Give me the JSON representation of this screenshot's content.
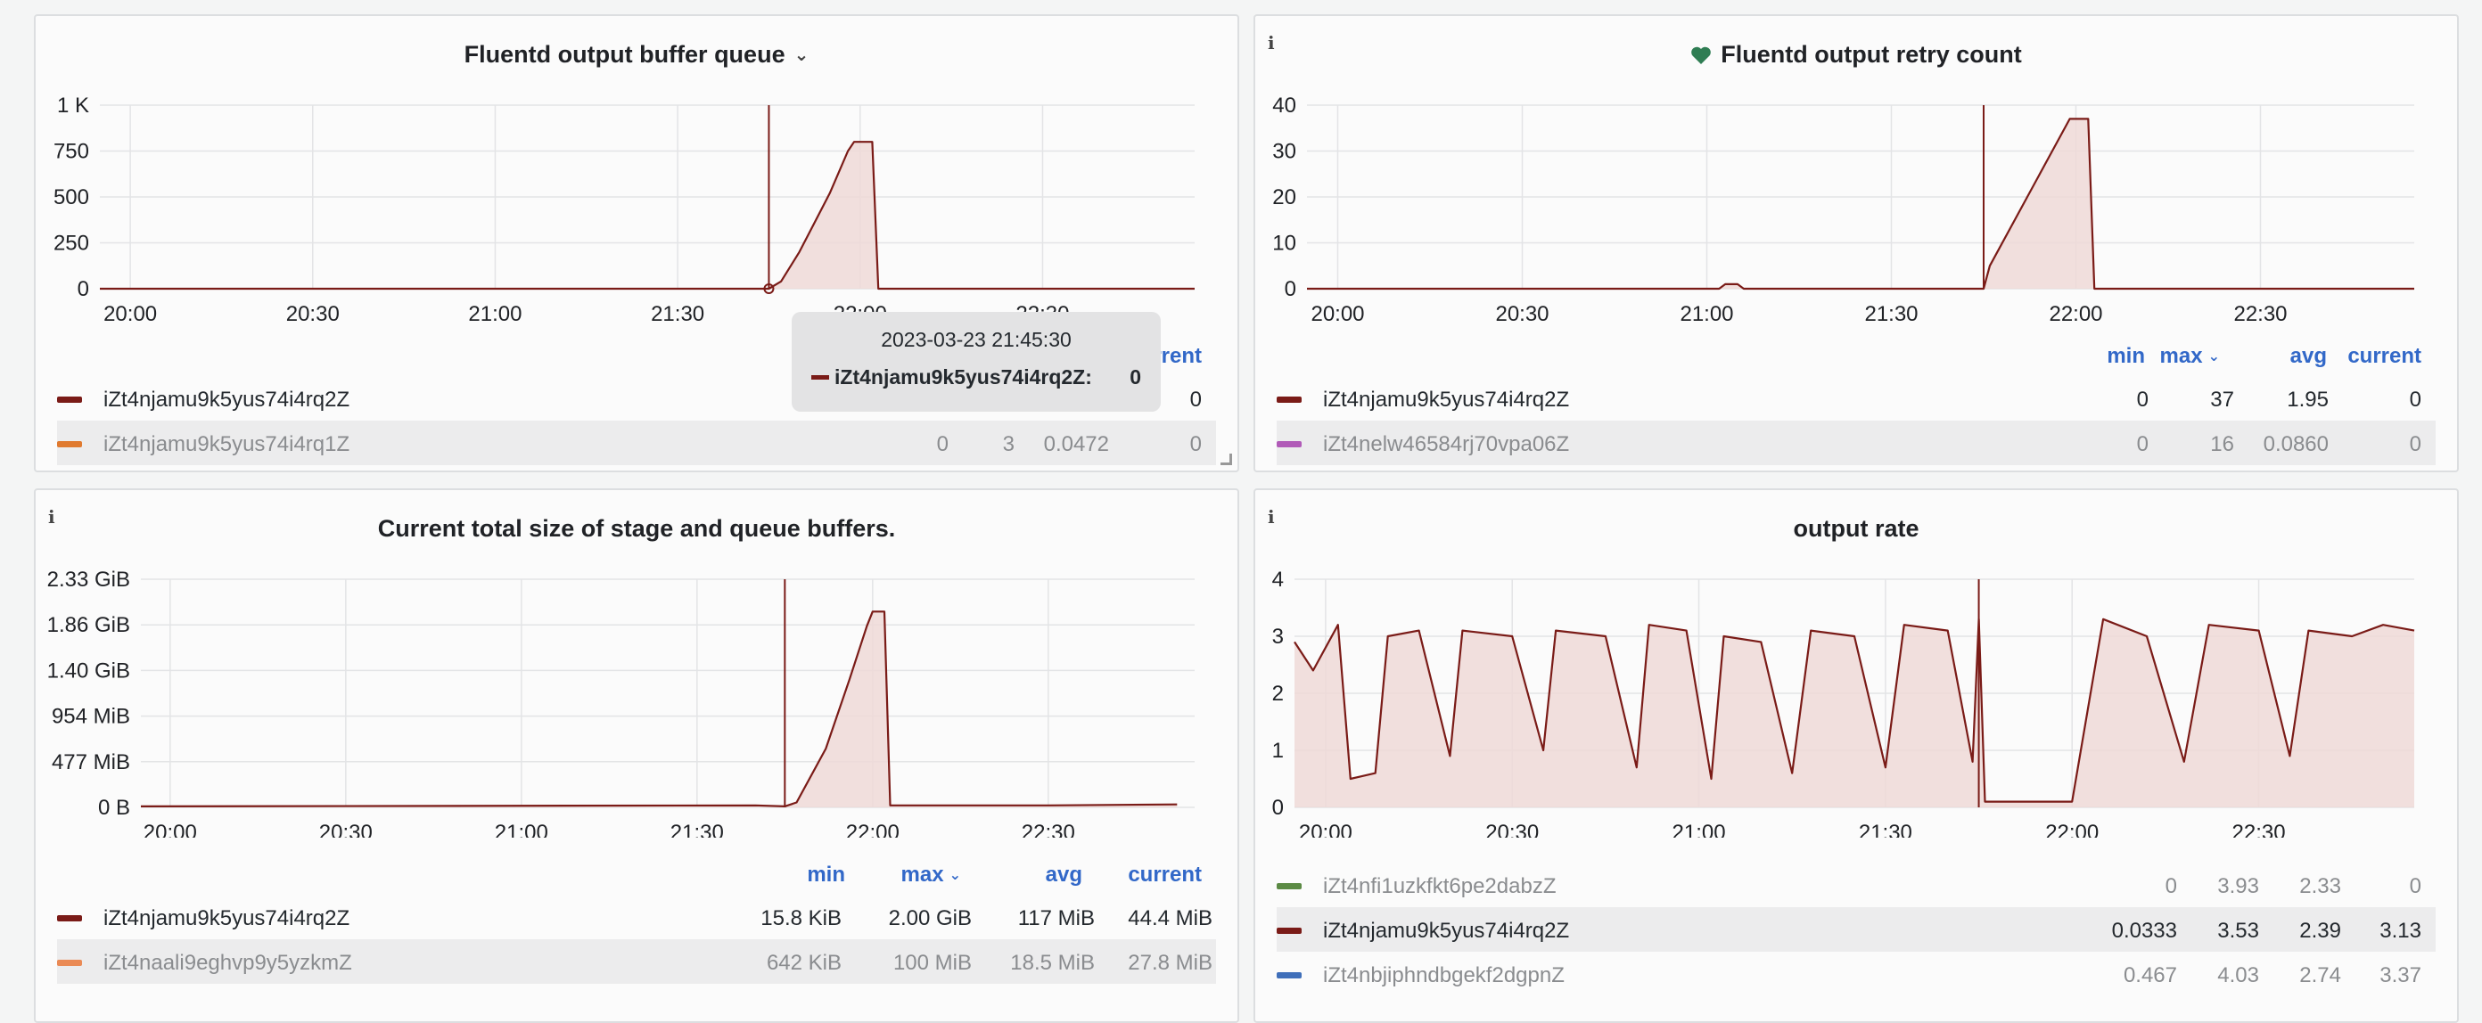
{
  "colors": {
    "series_main": "#7a1b17",
    "series_fill": "#eed9d7",
    "legend_orange": "#e07a2f",
    "legend_purple": "#b15bb8",
    "legend_green": "#5b8a44",
    "legend_blue": "#3f6fba",
    "legend_salmon": "#ea8a55",
    "link_blue": "#3268c8",
    "heart_green": "#2f7d53"
  },
  "panels": {
    "buffer_queue": {
      "title": "Fluentd output buffer queue",
      "chart_data": {
        "type": "area",
        "x_ticks": [
          "20:00",
          "20:30",
          "21:00",
          "21:30",
          "22:00",
          "22:30"
        ],
        "y_ticks": [
          "0",
          "250",
          "500",
          "750",
          "1 K"
        ],
        "ylim": [
          0,
          1000
        ],
        "xlim": [
          "19:55",
          "22:55"
        ],
        "series": [
          {
            "name": "iZt4njamu9k5yus74i4rq2Z",
            "points": [
              [
                "19:55",
                0
              ],
              [
                "21:45",
                0
              ],
              [
                "21:47",
                40
              ],
              [
                "21:50",
                200
              ],
              [
                "21:55",
                520
              ],
              [
                "21:58",
                750
              ],
              [
                "21:59",
                800
              ],
              [
                "22:02",
                800
              ],
              [
                "22:03",
                0
              ],
              [
                "22:55",
                0
              ]
            ]
          }
        ]
      },
      "legend": {
        "header_current": "current",
        "rows": [
          {
            "name": "iZt4njamu9k5yus74i4rq2Z",
            "min": "",
            "max": "",
            "avg": "",
            "current": "0"
          },
          {
            "name": "iZt4njamu9k5yus74i4rq1Z",
            "min": "0",
            "max": "3",
            "avg": "0.0472",
            "current": "0"
          }
        ]
      },
      "tooltip": {
        "time": "2023-03-23 21:45:30",
        "series_label": "iZt4njamu9k5yus74i4rq2Z:",
        "value": "0"
      }
    },
    "retry_count": {
      "title": "Fluentd output retry count",
      "chart_data": {
        "type": "area",
        "x_ticks": [
          "20:00",
          "20:30",
          "21:00",
          "21:30",
          "22:00",
          "22:30"
        ],
        "y_ticks": [
          "0",
          "10",
          "20",
          "30",
          "40"
        ],
        "ylim": [
          0,
          40
        ],
        "xlim": [
          "19:55",
          "22:55"
        ],
        "series": [
          {
            "name": "iZt4njamu9k5yus74i4rq2Z",
            "points": [
              [
                "19:55",
                0
              ],
              [
                "21:02",
                0
              ],
              [
                "21:03",
                1
              ],
              [
                "21:05",
                1
              ],
              [
                "21:06",
                0
              ],
              [
                "21:45",
                0
              ],
              [
                "21:46",
                5
              ],
              [
                "21:59",
                37
              ],
              [
                "22:02",
                37
              ],
              [
                "22:03",
                0
              ],
              [
                "22:55",
                0
              ]
            ]
          }
        ]
      },
      "legend": {
        "headers": {
          "min": "min",
          "max": "max",
          "avg": "avg",
          "current": "current"
        },
        "rows": [
          {
            "name": "iZt4njamu9k5yus74i4rq2Z",
            "min": "0",
            "max": "37",
            "avg": "1.95",
            "current": "0"
          },
          {
            "name": "iZt4nelw46584rj70vpa06Z",
            "min": "0",
            "max": "16",
            "avg": "0.0860",
            "current": "0"
          }
        ]
      }
    },
    "stage_size": {
      "title": "Current total size of stage and queue buffers.",
      "chart_data": {
        "type": "area",
        "x_ticks": [
          "20:00",
          "20:30",
          "21:00",
          "21:30",
          "22:00",
          "22:30"
        ],
        "y_ticks": [
          "0 B",
          "477 MiB",
          "954 MiB",
          "1.40 GiB",
          "1.86 GiB",
          "2.33 GiB"
        ],
        "ylim": [
          0,
          2.33
        ],
        "xlim": [
          "19:55",
          "22:55"
        ],
        "series": [
          {
            "name": "iZt4njamu9k5yus74i4rq2Z",
            "points": [
              [
                "19:55",
                0.01
              ],
              [
                "21:40",
                0.02
              ],
              [
                "21:45",
                0.01
              ],
              [
                "21:47",
                0.05
              ],
              [
                "21:52",
                0.6
              ],
              [
                "21:56",
                1.3
              ],
              [
                "21:59",
                1.85
              ],
              [
                "22:00",
                2.0
              ],
              [
                "22:02",
                2.0
              ],
              [
                "22:03",
                0.02
              ],
              [
                "22:30",
                0.02
              ],
              [
                "22:52",
                0.03
              ]
            ]
          }
        ]
      },
      "legend": {
        "headers": {
          "min": "min",
          "max": "max",
          "avg": "avg",
          "current": "current"
        },
        "rows": [
          {
            "name": "iZt4njamu9k5yus74i4rq2Z",
            "min": "15.8 KiB",
            "max": "2.00 GiB",
            "avg": "117 MiB",
            "current": "44.4 MiB"
          },
          {
            "name": "iZt4naali9eghvp9y5yzkmZ",
            "min": "642 KiB",
            "max": "100 MiB",
            "avg": "18.5 MiB",
            "current": "27.8 MiB"
          }
        ]
      }
    },
    "output_rate": {
      "title": "output rate",
      "chart_data": {
        "type": "area",
        "x_ticks": [
          "20:00",
          "20:30",
          "21:00",
          "21:30",
          "22:00",
          "22:30"
        ],
        "y_ticks": [
          "0",
          "1",
          "2",
          "3",
          "4"
        ],
        "ylim": [
          0,
          4
        ],
        "xlim": [
          "19:55",
          "22:55"
        ],
        "series": [
          {
            "name": "iZt4njamu9k5yus74i4rq2Z",
            "points": [
              [
                "19:55",
                2.9
              ],
              [
                "19:58",
                2.4
              ],
              [
                "20:02",
                3.2
              ],
              [
                "20:04",
                0.5
              ],
              [
                "20:08",
                0.6
              ],
              [
                "20:10",
                3.0
              ],
              [
                "20:15",
                3.1
              ],
              [
                "20:20",
                0.9
              ],
              [
                "20:22",
                3.1
              ],
              [
                "20:30",
                3.0
              ],
              [
                "20:35",
                1.0
              ],
              [
                "20:37",
                3.1
              ],
              [
                "20:45",
                3.0
              ],
              [
                "20:50",
                0.7
              ],
              [
                "20:52",
                3.2
              ],
              [
                "20:58",
                3.1
              ],
              [
                "21:02",
                0.5
              ],
              [
                "21:04",
                3.0
              ],
              [
                "21:10",
                2.9
              ],
              [
                "21:15",
                0.6
              ],
              [
                "21:18",
                3.1
              ],
              [
                "21:25",
                3.0
              ],
              [
                "21:30",
                0.7
              ],
              [
                "21:33",
                3.2
              ],
              [
                "21:40",
                3.1
              ],
              [
                "21:44",
                0.8
              ],
              [
                "21:45",
                3.3
              ],
              [
                "21:46",
                0.1
              ],
              [
                "22:00",
                0.1
              ],
              [
                "22:05",
                3.3
              ],
              [
                "22:12",
                3.0
              ],
              [
                "22:18",
                0.8
              ],
              [
                "22:22",
                3.2
              ],
              [
                "22:30",
                3.1
              ],
              [
                "22:35",
                0.9
              ],
              [
                "22:38",
                3.1
              ],
              [
                "22:45",
                3.0
              ],
              [
                "22:50",
                3.2
              ],
              [
                "22:55",
                3.1
              ]
            ]
          }
        ]
      },
      "legend": {
        "rows": [
          {
            "name": "iZt4nfi1uzkfkt6pe2dabzZ",
            "min": "0",
            "max": "3.93",
            "avg": "2.33",
            "current": "0"
          },
          {
            "name": "iZt4njamu9k5yus74i4rq2Z",
            "min": "0.0333",
            "max": "3.53",
            "avg": "2.39",
            "current": "3.13"
          },
          {
            "name": "iZt4nbjiphndbgekf2dgpnZ",
            "min": "0.467",
            "max": "4.03",
            "avg": "2.74",
            "current": "3.37"
          }
        ]
      }
    }
  }
}
